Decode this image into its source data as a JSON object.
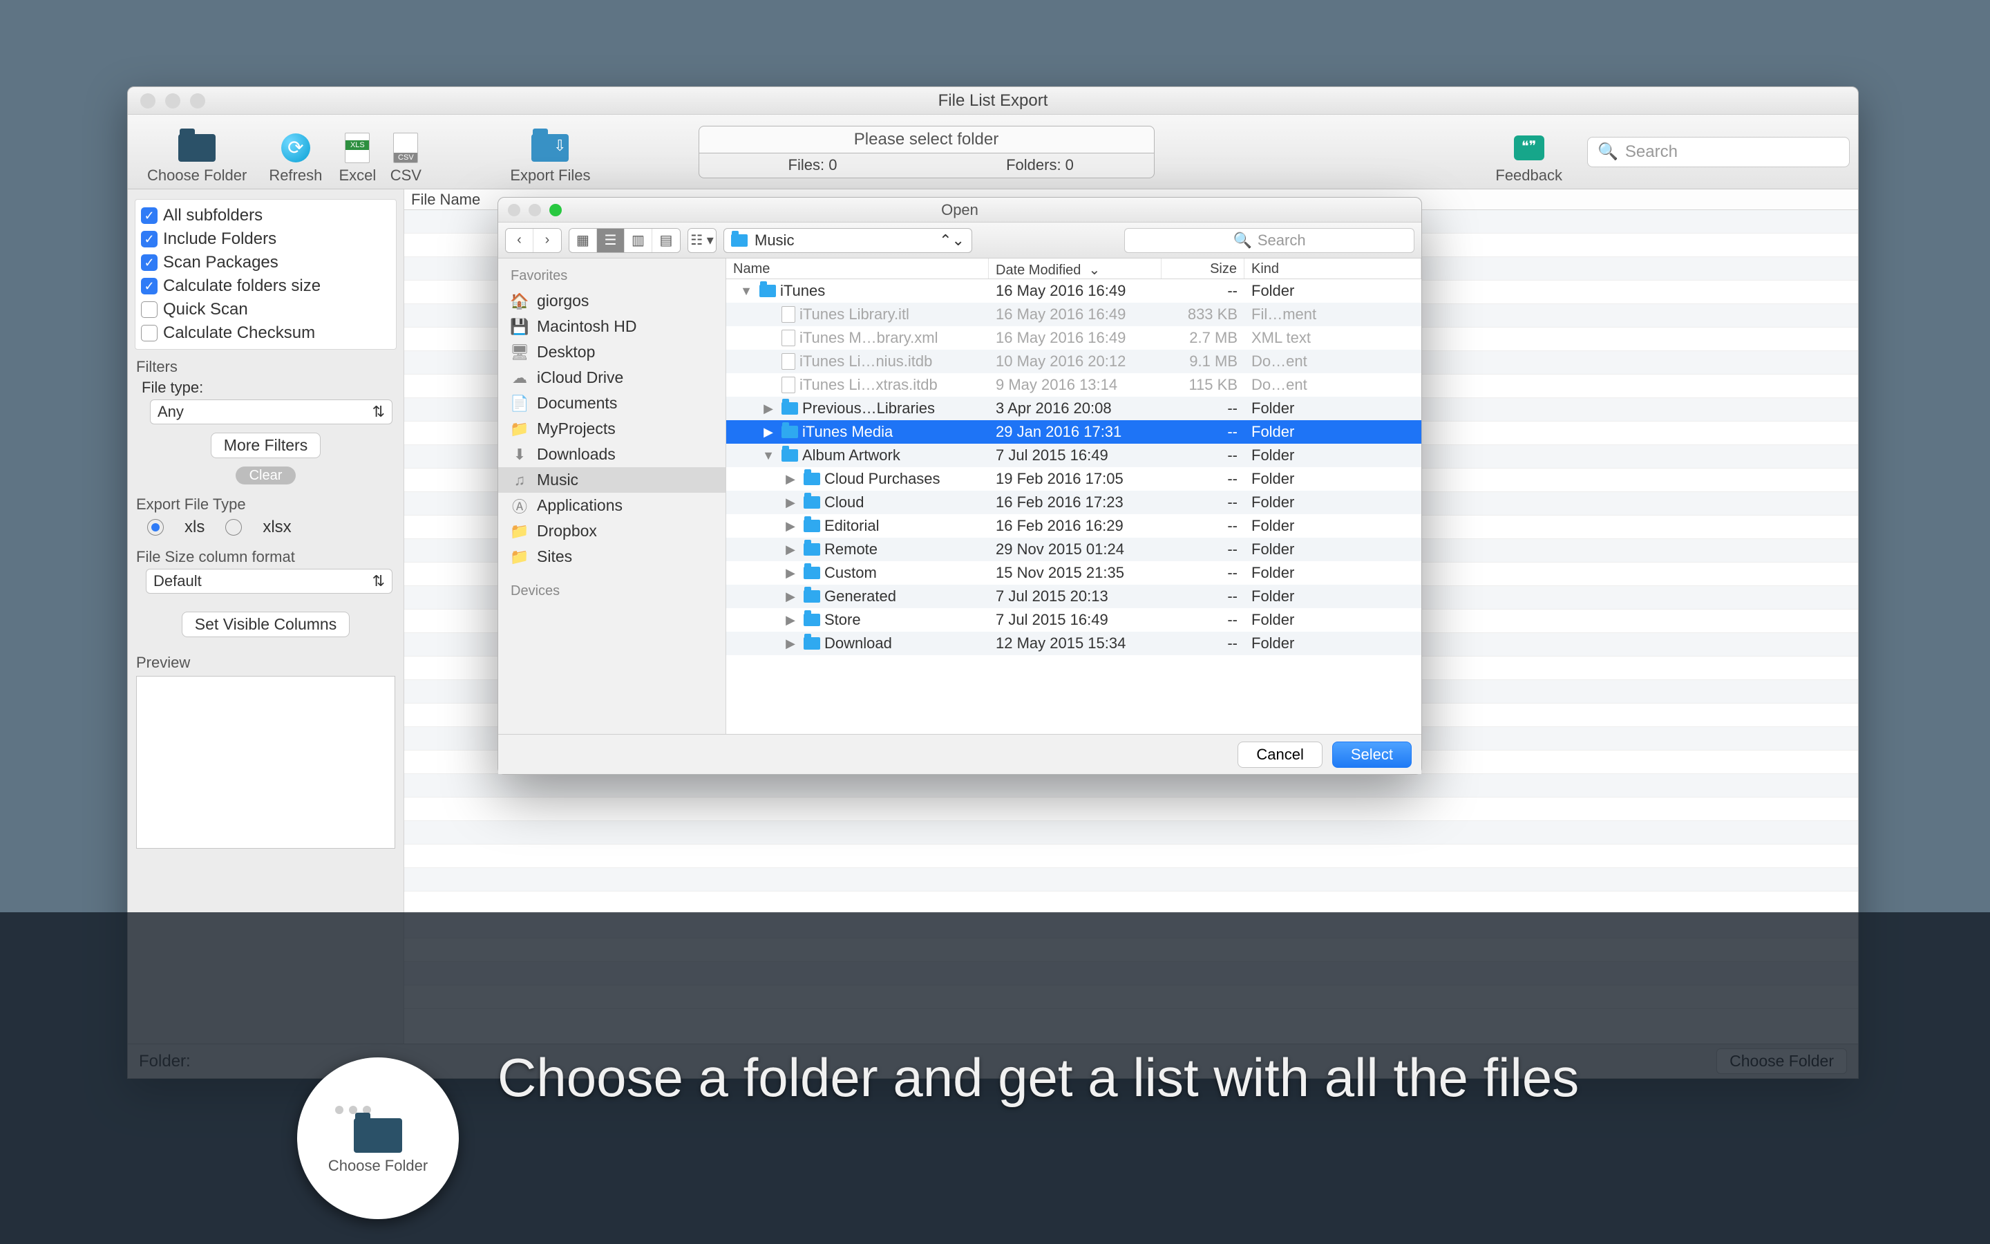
{
  "app": {
    "title": "File List Export",
    "toolbar": {
      "choose": "Choose Folder",
      "refresh": "Refresh",
      "excel": "Excel",
      "csv": "CSV",
      "export": "Export Files",
      "feedback": "Feedback",
      "hint": "Please select folder",
      "files_count": "Files: 0",
      "folders_count": "Folders: 0",
      "search_placeholder": "Search"
    },
    "sidebar": {
      "options": [
        {
          "label": "All subfolders",
          "checked": true
        },
        {
          "label": "Include Folders",
          "checked": true
        },
        {
          "label": "Scan Packages",
          "checked": true
        },
        {
          "label": "Calculate folders size",
          "checked": true
        },
        {
          "label": "Quick Scan",
          "checked": false
        },
        {
          "label": "Calculate Checksum",
          "checked": false
        }
      ],
      "filters_header": "Filters",
      "filetype_label": "File type:",
      "filetype_value": "Any",
      "more_filters": "More Filters",
      "clear": "Clear",
      "export_type_header": "Export File Type",
      "radio_xls": "xls",
      "radio_xlsx": "xlsx",
      "filesize_header": "File Size column format",
      "filesize_value": "Default",
      "set_columns": "Set Visible Columns",
      "preview": "Preview"
    },
    "main": {
      "col_filename": "File Name"
    },
    "statusbar": {
      "folder_label": "Folder:",
      "choose_btn": "Choose Folder"
    }
  },
  "open_panel": {
    "title": "Open",
    "path": "Music",
    "search_placeholder": "Search",
    "sidebar_header_fav": "Favorites",
    "sidebar_header_dev": "Devices",
    "favorites": [
      {
        "icon": "🏠",
        "label": "giorgos"
      },
      {
        "icon": "💾",
        "label": "Macintosh HD"
      },
      {
        "icon": "🖥",
        "label": "Desktop"
      },
      {
        "icon": "☁",
        "label": "iCloud Drive"
      },
      {
        "icon": "📄",
        "label": "Documents"
      },
      {
        "icon": "📁",
        "label": "MyProjects"
      },
      {
        "icon": "⬇",
        "label": "Downloads"
      },
      {
        "icon": "♫",
        "label": "Music",
        "selected": true
      },
      {
        "icon": "Ⓐ",
        "label": "Applications"
      },
      {
        "icon": "📁",
        "label": "Dropbox"
      },
      {
        "icon": "📁",
        "label": "Sites"
      }
    ],
    "columns": {
      "name": "Name",
      "date": "Date Modified",
      "size": "Size",
      "kind": "Kind"
    },
    "rows": [
      {
        "indent": 0,
        "disclose": "▼",
        "folder": true,
        "name": "iTunes",
        "date": "16 May 2016 16:49",
        "size": "--",
        "kind": "Folder"
      },
      {
        "indent": 1,
        "dimmed": true,
        "name": "iTunes Library.itl",
        "date": "16 May 2016 16:49",
        "size": "833 KB",
        "kind": "Fil…ment"
      },
      {
        "indent": 1,
        "dimmed": true,
        "name": "iTunes M…brary.xml",
        "date": "16 May 2016 16:49",
        "size": "2.7 MB",
        "kind": "XML text"
      },
      {
        "indent": 1,
        "dimmed": true,
        "name": "iTunes Li…nius.itdb",
        "date": "10 May 2016 20:12",
        "size": "9.1 MB",
        "kind": "Do…ent"
      },
      {
        "indent": 1,
        "dimmed": true,
        "name": "iTunes Li…xtras.itdb",
        "date": "9 May 2016 13:14",
        "size": "115 KB",
        "kind": "Do…ent"
      },
      {
        "indent": 1,
        "disclose": "▶",
        "folder": true,
        "name": "Previous…Libraries",
        "date": "3 Apr 2016 20:08",
        "size": "--",
        "kind": "Folder"
      },
      {
        "indent": 1,
        "disclose": "▶",
        "folder": true,
        "selected": true,
        "name": "iTunes Media",
        "date": "29 Jan 2016 17:31",
        "size": "--",
        "kind": "Folder"
      },
      {
        "indent": 1,
        "disclose": "▼",
        "folder": true,
        "name": "Album Artwork",
        "date": "7 Jul 2015 16:49",
        "size": "--",
        "kind": "Folder"
      },
      {
        "indent": 2,
        "disclose": "▶",
        "folder": true,
        "name": "Cloud Purchases",
        "date": "19 Feb 2016 17:05",
        "size": "--",
        "kind": "Folder"
      },
      {
        "indent": 2,
        "disclose": "▶",
        "folder": true,
        "name": "Cloud",
        "date": "16 Feb 2016 17:23",
        "size": "--",
        "kind": "Folder"
      },
      {
        "indent": 2,
        "disclose": "▶",
        "folder": true,
        "name": "Editorial",
        "date": "16 Feb 2016 16:29",
        "size": "--",
        "kind": "Folder"
      },
      {
        "indent": 2,
        "disclose": "▶",
        "folder": true,
        "name": "Remote",
        "date": "29 Nov 2015 01:24",
        "size": "--",
        "kind": "Folder"
      },
      {
        "indent": 2,
        "disclose": "▶",
        "folder": true,
        "name": "Custom",
        "date": "15 Nov 2015 21:35",
        "size": "--",
        "kind": "Folder"
      },
      {
        "indent": 2,
        "disclose": "▶",
        "folder": true,
        "name": "Generated",
        "date": "7 Jul 2015 20:13",
        "size": "--",
        "kind": "Folder"
      },
      {
        "indent": 2,
        "disclose": "▶",
        "folder": true,
        "name": "Store",
        "date": "7 Jul 2015 16:49",
        "size": "--",
        "kind": "Folder"
      },
      {
        "indent": 2,
        "disclose": "▶",
        "folder": true,
        "name": "Download",
        "date": "12 May 2015 15:34",
        "size": "--",
        "kind": "Folder"
      }
    ],
    "cancel": "Cancel",
    "select": "Select"
  },
  "overlay": {
    "text": "Choose a folder and get a list with all the files",
    "zoom_label": "Choose Folder"
  }
}
